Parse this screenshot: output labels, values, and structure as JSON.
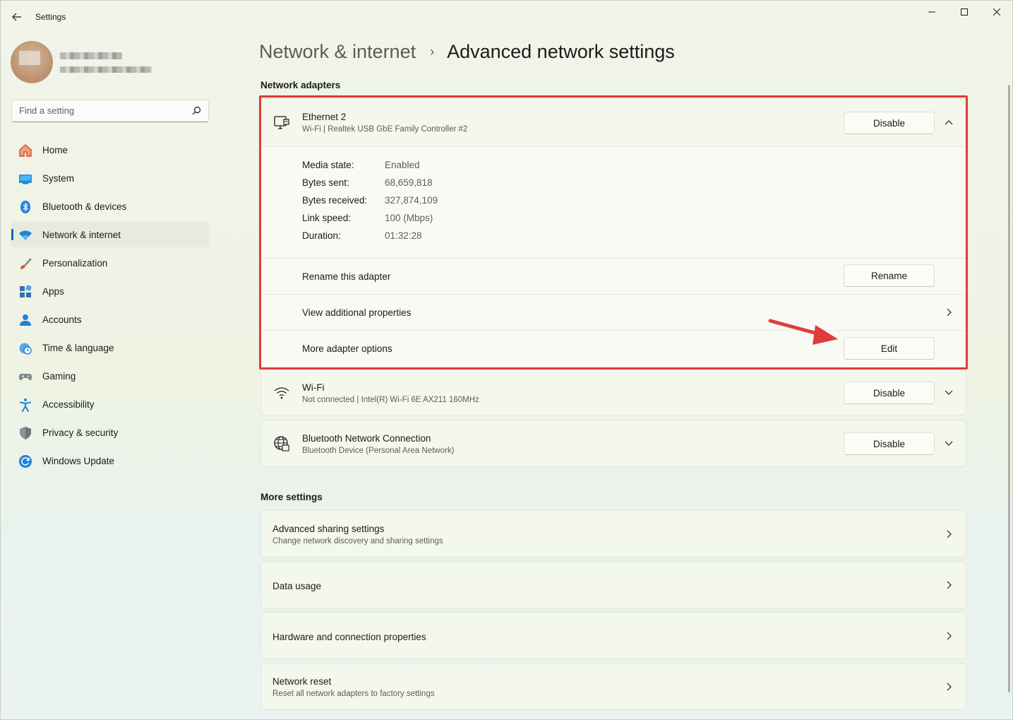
{
  "window": {
    "title": "Settings",
    "controls": {
      "minimize": "—",
      "maximize": "☐",
      "close": "✕"
    }
  },
  "profile": {
    "name": "",
    "email": ""
  },
  "search": {
    "placeholder": "Find a setting"
  },
  "nav": [
    {
      "label": "Home",
      "icon": "home-icon"
    },
    {
      "label": "System",
      "icon": "system-icon"
    },
    {
      "label": "Bluetooth & devices",
      "icon": "bluetooth-icon"
    },
    {
      "label": "Network & internet",
      "icon": "wifi-icon",
      "active": true
    },
    {
      "label": "Personalization",
      "icon": "brush-icon"
    },
    {
      "label": "Apps",
      "icon": "apps-icon"
    },
    {
      "label": "Accounts",
      "icon": "account-icon"
    },
    {
      "label": "Time & language",
      "icon": "clock-globe-icon"
    },
    {
      "label": "Gaming",
      "icon": "gamepad-icon"
    },
    {
      "label": "Accessibility",
      "icon": "accessibility-icon"
    },
    {
      "label": "Privacy & security",
      "icon": "shield-icon"
    },
    {
      "label": "Windows Update",
      "icon": "update-icon"
    }
  ],
  "breadcrumb": {
    "parent": "Network & internet",
    "separator": "›",
    "current": "Advanced network settings"
  },
  "sections": {
    "adapters": "Network adapters",
    "more": "More settings"
  },
  "adapters": [
    {
      "name": "Ethernet 2",
      "description": "Wi-Fi | Realtek USB GbE Family Controller #2",
      "action": "Disable",
      "expanded": true,
      "details": [
        {
          "key": "Media state:",
          "value": "Enabled"
        },
        {
          "key": "Bytes sent:",
          "value": "68,659,818"
        },
        {
          "key": "Bytes received:",
          "value": "327,874,109"
        },
        {
          "key": "Link speed:",
          "value": "100 (Mbps)"
        },
        {
          "key": "Duration:",
          "value": "01:32:28"
        }
      ],
      "rows": [
        {
          "label": "Rename this adapter",
          "button": "Rename"
        },
        {
          "label": "View additional properties"
        },
        {
          "label": "More adapter options",
          "button": "Edit"
        }
      ]
    },
    {
      "name": "Wi-Fi",
      "description": "Not connected | Intel(R) Wi-Fi 6E AX211 160MHz",
      "action": "Disable"
    },
    {
      "name": "Bluetooth Network Connection",
      "description": "Bluetooth Device (Personal Area Network)",
      "action": "Disable"
    }
  ],
  "more_settings": [
    {
      "title": "Advanced sharing settings",
      "subtitle": "Change network discovery and sharing settings"
    },
    {
      "title": "Data usage"
    },
    {
      "title": "Hardware and connection properties"
    },
    {
      "title": "Network reset",
      "subtitle": "Reset all network adapters to factory settings"
    }
  ],
  "colors": {
    "accent": "#0067c0",
    "highlight": "#e03b3b"
  }
}
